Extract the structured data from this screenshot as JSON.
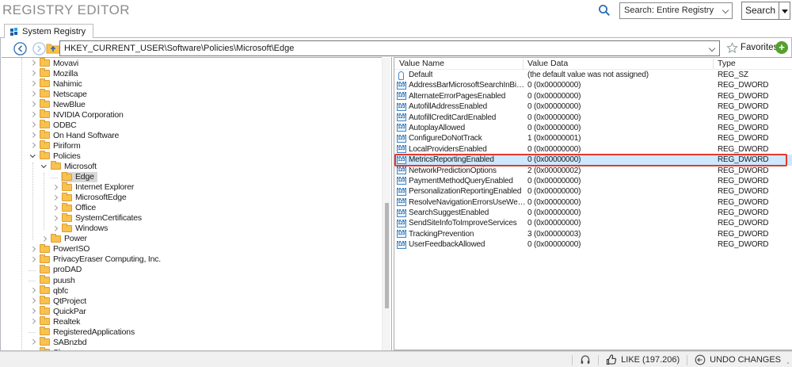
{
  "app": {
    "title": "REGISTRY EDITOR"
  },
  "search": {
    "scope": "Search: Entire Registry",
    "button_label": "Search"
  },
  "tabs": {
    "system_registry": "System Registry"
  },
  "address": {
    "path": "HKEY_CURRENT_USER\\Software\\Policies\\Microsoft\\Edge",
    "favorites_label": "Favorites"
  },
  "tree": {
    "items": [
      {
        "label": "Movavi",
        "depth": 1,
        "state": "collapsed",
        "selected": false
      },
      {
        "label": "Mozilla",
        "depth": 1,
        "state": "collapsed",
        "selected": false
      },
      {
        "label": "Nahimic",
        "depth": 1,
        "state": "collapsed",
        "selected": false
      },
      {
        "label": "Netscape",
        "depth": 1,
        "state": "collapsed",
        "selected": false
      },
      {
        "label": "NewBlue",
        "depth": 1,
        "state": "collapsed",
        "selected": false
      },
      {
        "label": "NVIDIA Corporation",
        "depth": 1,
        "state": "collapsed",
        "selected": false
      },
      {
        "label": "ODBC",
        "depth": 1,
        "state": "collapsed",
        "selected": false
      },
      {
        "label": "On Hand Software",
        "depth": 1,
        "state": "collapsed",
        "selected": false
      },
      {
        "label": "Piriform",
        "depth": 1,
        "state": "collapsed",
        "selected": false
      },
      {
        "label": "Policies",
        "depth": 1,
        "state": "expanded",
        "selected": false
      },
      {
        "label": "Microsoft",
        "depth": 2,
        "state": "expanded",
        "selected": false
      },
      {
        "label": "Edge",
        "depth": 3,
        "state": "none",
        "selected": true
      },
      {
        "label": "Internet Explorer",
        "depth": 3,
        "state": "collapsed",
        "selected": false
      },
      {
        "label": "MicrosoftEdge",
        "depth": 3,
        "state": "collapsed",
        "selected": false
      },
      {
        "label": "Office",
        "depth": 3,
        "state": "collapsed",
        "selected": false
      },
      {
        "label": "SystemCertificates",
        "depth": 3,
        "state": "collapsed",
        "selected": false
      },
      {
        "label": "Windows",
        "depth": 3,
        "state": "collapsed",
        "selected": false
      },
      {
        "label": "Power",
        "depth": 2,
        "state": "collapsed",
        "selected": false
      },
      {
        "label": "PowerISO",
        "depth": 1,
        "state": "collapsed",
        "selected": false
      },
      {
        "label": "PrivacyEraser Computing, Inc.",
        "depth": 1,
        "state": "collapsed",
        "selected": false
      },
      {
        "label": "proDAD",
        "depth": 1,
        "state": "none",
        "selected": false
      },
      {
        "label": "puush",
        "depth": 1,
        "state": "none",
        "selected": false
      },
      {
        "label": "qbfc",
        "depth": 1,
        "state": "collapsed",
        "selected": false
      },
      {
        "label": "QtProject",
        "depth": 1,
        "state": "collapsed",
        "selected": false
      },
      {
        "label": "QuickPar",
        "depth": 1,
        "state": "collapsed",
        "selected": false
      },
      {
        "label": "Realtek",
        "depth": 1,
        "state": "collapsed",
        "selected": false
      },
      {
        "label": "RegisteredApplications",
        "depth": 1,
        "state": "none",
        "selected": false
      },
      {
        "label": "SABnzbd",
        "depth": 1,
        "state": "collapsed",
        "selected": false
      },
      {
        "label": "Sharman",
        "depth": 1,
        "state": "none",
        "selected": false
      }
    ]
  },
  "list": {
    "columns": {
      "name": "Value Name",
      "data": "Value Data",
      "type": "Type"
    },
    "rows": [
      {
        "name": "Default",
        "data": "(the default value was not assigned)",
        "type": "REG_SZ",
        "icon": "string",
        "selected": false
      },
      {
        "name": "AddressBarMicrosoftSearchInBingPr...",
        "data": "0 (0x00000000)",
        "type": "REG_DWORD",
        "icon": "dword",
        "selected": false
      },
      {
        "name": "AlternateErrorPagesEnabled",
        "data": "0 (0x00000000)",
        "type": "REG_DWORD",
        "icon": "dword",
        "selected": false
      },
      {
        "name": "AutofillAddressEnabled",
        "data": "0 (0x00000000)",
        "type": "REG_DWORD",
        "icon": "dword",
        "selected": false
      },
      {
        "name": "AutofillCreditCardEnabled",
        "data": "0 (0x00000000)",
        "type": "REG_DWORD",
        "icon": "dword",
        "selected": false
      },
      {
        "name": "AutoplayAllowed",
        "data": "0 (0x00000000)",
        "type": "REG_DWORD",
        "icon": "dword",
        "selected": false
      },
      {
        "name": "ConfigureDoNotTrack",
        "data": "1 (0x00000001)",
        "type": "REG_DWORD",
        "icon": "dword",
        "selected": false
      },
      {
        "name": "LocalProvidersEnabled",
        "data": "0 (0x00000000)",
        "type": "REG_DWORD",
        "icon": "dword",
        "selected": false
      },
      {
        "name": "MetricsReportingEnabled",
        "data": "0 (0x00000000)",
        "type": "REG_DWORD",
        "icon": "dword",
        "selected": true
      },
      {
        "name": "NetworkPredictionOptions",
        "data": "2 (0x00000002)",
        "type": "REG_DWORD",
        "icon": "dword",
        "selected": false
      },
      {
        "name": "PaymentMethodQueryEnabled",
        "data": "0 (0x00000000)",
        "type": "REG_DWORD",
        "icon": "dword",
        "selected": false
      },
      {
        "name": "PersonalizationReportingEnabled",
        "data": "0 (0x00000000)",
        "type": "REG_DWORD",
        "icon": "dword",
        "selected": false
      },
      {
        "name": "ResolveNavigationErrorsUseWebSer...",
        "data": "0 (0x00000000)",
        "type": "REG_DWORD",
        "icon": "dword",
        "selected": false
      },
      {
        "name": "SearchSuggestEnabled",
        "data": "0 (0x00000000)",
        "type": "REG_DWORD",
        "icon": "dword",
        "selected": false
      },
      {
        "name": "SendSiteInfoToImproveServices",
        "data": "0 (0x00000000)",
        "type": "REG_DWORD",
        "icon": "dword",
        "selected": false
      },
      {
        "name": "TrackingPrevention",
        "data": "3 (0x00000003)",
        "type": "REG_DWORD",
        "icon": "dword",
        "selected": false
      },
      {
        "name": "UserFeedbackAllowed",
        "data": "0 (0x00000000)",
        "type": "REG_DWORD",
        "icon": "dword",
        "selected": false
      }
    ]
  },
  "status": {
    "like_label": "LIKE (197.206)",
    "undo_label": "UNDO CHANGES"
  },
  "colors": {
    "accent_blue": "#2f6fb2",
    "selection_blue": "#cde8ff",
    "highlight_red": "#e23a30",
    "folder_yellow": "#f9c14d",
    "plus_green": "#55a02e",
    "tree_selected_gray": "#d8d8d8"
  }
}
